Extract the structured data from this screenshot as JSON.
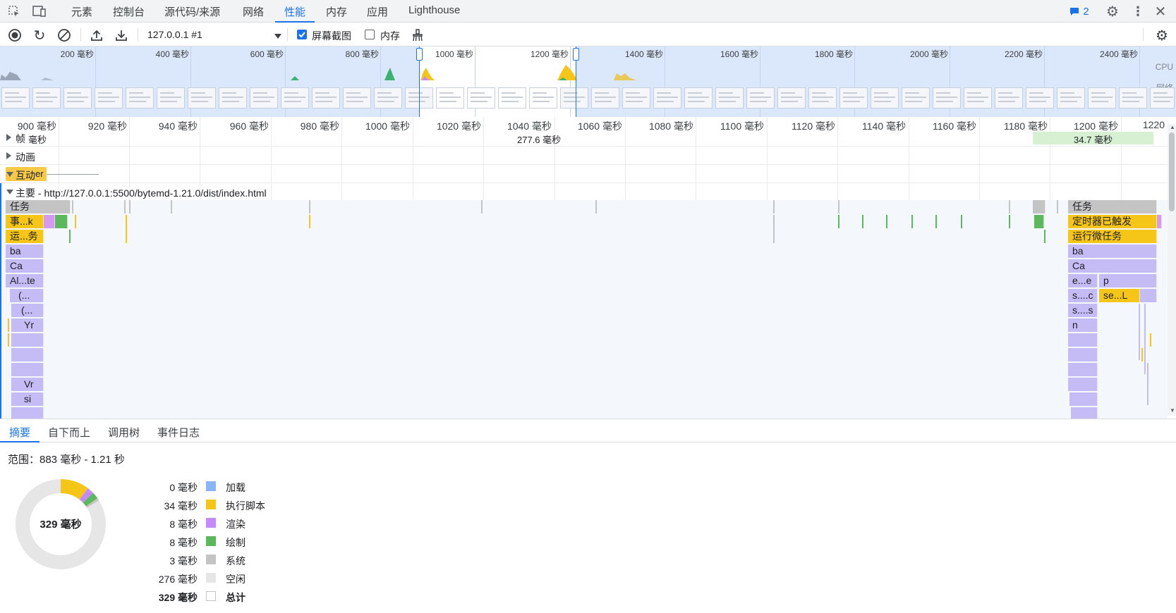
{
  "topbar": {
    "tabs": [
      "元素",
      "控制台",
      "源代码/来源",
      "网络",
      "性能",
      "内存",
      "应用",
      "Lighthouse"
    ],
    "active_tab": "性能",
    "issues_count": "2"
  },
  "toolbar": {
    "target": "127.0.0.1 #1",
    "screenshots_label": "屏幕截图",
    "screenshots_checked": true,
    "memory_label": "内存",
    "memory_checked": false
  },
  "overview": {
    "ticks": [
      "200 毫秒",
      "400 毫秒",
      "600 毫秒",
      "800 毫秒",
      "1000 毫秒",
      "1200 毫秒",
      "1400 毫秒",
      "1600 毫秒",
      "1800 毫秒",
      "2000 毫秒",
      "2200 毫秒",
      "2400 毫秒"
    ],
    "cpu_label": "CPU",
    "network_label": "网络"
  },
  "ruler": {
    "ticks": [
      "900 毫秒",
      "920 毫秒",
      "940 毫秒",
      "960 毫秒",
      "980 毫秒",
      "1000 毫秒",
      "1020 毫秒",
      "1040 毫秒",
      "1060 毫秒",
      "1080 毫秒",
      "1100 毫秒",
      "1120 毫秒",
      "1140 毫秒",
      "1160 毫秒",
      "1180 毫秒",
      "1200 毫秒",
      "1220"
    ]
  },
  "tracks": {
    "frames_label": "帧",
    "frames_sub": "毫秒",
    "frame_duration_1": "277.6 毫秒",
    "frame_duration_2": "34.7 毫秒",
    "animations_label": "动画",
    "interactions_label": "互动",
    "interaction_chip": "er",
    "main_label": "主要 - http://127.0.0.1:5500/bytemd-1.21.0/dist/index.html"
  },
  "flame_left": [
    "任务",
    "事...k",
    "运...务",
    "ba",
    "Ca",
    "Al...te",
    "(...",
    "(...",
    "Yr",
    "Vr",
    "si"
  ],
  "flame_right": [
    "任务",
    "定时器已触发",
    "运行微任务",
    "ba",
    "Ca",
    "e...e",
    "p",
    "s....c",
    "se...L",
    "s....s",
    "n"
  ],
  "bottom_tabs": [
    "摘要",
    "自下而上",
    "调用树",
    "事件日志"
  ],
  "summary": {
    "range": "范围：883 毫秒 - 1.21 秒",
    "total_center": "329 毫秒",
    "rows": [
      {
        "value": "0 毫秒",
        "label": "加载",
        "color": "#8ab4f8"
      },
      {
        "value": "34 毫秒",
        "label": "执行脚本",
        "color": "#f5c518"
      },
      {
        "value": "8 毫秒",
        "label": "渲染",
        "color": "#c58af9"
      },
      {
        "value": "8 毫秒",
        "label": "绘制",
        "color": "#5cb85c"
      },
      {
        "value": "3 毫秒",
        "label": "系统",
        "color": "#c4c4c4"
      },
      {
        "value": "276 毫秒",
        "label": "空闲",
        "color": "#e6e6e6"
      },
      {
        "value": "329 毫秒",
        "label": "总计",
        "color": "#ffffff"
      }
    ]
  }
}
